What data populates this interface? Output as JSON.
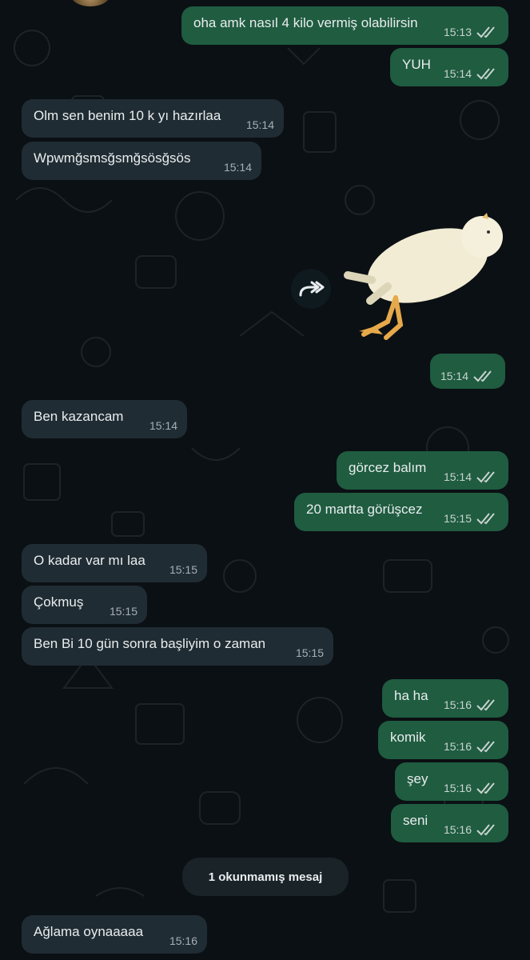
{
  "messages": [
    {
      "id": "m1",
      "dir": "out",
      "text": "oha amk nasıl 4 kilo vermiş olabilirsin",
      "time": "15:13",
      "read": true
    },
    {
      "id": "m2",
      "dir": "out",
      "text": "YUH",
      "time": "15:14",
      "read": true
    },
    {
      "id": "m3",
      "dir": "in",
      "text": "Olm sen benim 10 k yı hazırlaa",
      "time": "15:14"
    },
    {
      "id": "m4",
      "dir": "in",
      "text": "Wpwmğsmsğsmğsösğsös",
      "time": "15:14"
    },
    {
      "id": "m5",
      "dir": "out",
      "text": "",
      "time": "15:14",
      "read": true
    },
    {
      "id": "m6",
      "dir": "in",
      "text": "Ben kazancam",
      "time": "15:14"
    },
    {
      "id": "m7",
      "dir": "out",
      "text": "görcez balım",
      "time": "15:14",
      "read": true
    },
    {
      "id": "m8",
      "dir": "out",
      "text": "20 martta görüşcez",
      "time": "15:15",
      "read": true
    },
    {
      "id": "m9",
      "dir": "in",
      "text": "O kadar var mı laa",
      "time": "15:15"
    },
    {
      "id": "m10",
      "dir": "in",
      "text": "Çokmuş",
      "time": "15:15"
    },
    {
      "id": "m11",
      "dir": "in",
      "text": "Ben Bi 10 gün sonra başliyim o zaman",
      "time": "15:15"
    },
    {
      "id": "m12",
      "dir": "out",
      "text": "ha ha",
      "time": "15:16",
      "read": true
    },
    {
      "id": "m13",
      "dir": "out",
      "text": "komik",
      "time": "15:16",
      "read": true
    },
    {
      "id": "m14",
      "dir": "out",
      "text": "şey",
      "time": "15:16",
      "read": true
    },
    {
      "id": "m15",
      "dir": "out",
      "text": "seni",
      "time": "15:16",
      "read": true
    },
    {
      "id": "m16",
      "dir": "in",
      "text": "Ağlama oynaaaaa",
      "time": "15:16"
    }
  ],
  "sticker": {
    "icon": "chick-sticker",
    "caption": ""
  },
  "forward": {
    "icon": "forward-icon"
  },
  "unread_divider": "1 okunmamış mesaj",
  "colors": {
    "background": "#0b1014",
    "incoming_bubble": "#202c33",
    "outgoing_bubble": "#1f5c40",
    "text": "#e9edef",
    "read_ticks": "#c9d4d0"
  }
}
